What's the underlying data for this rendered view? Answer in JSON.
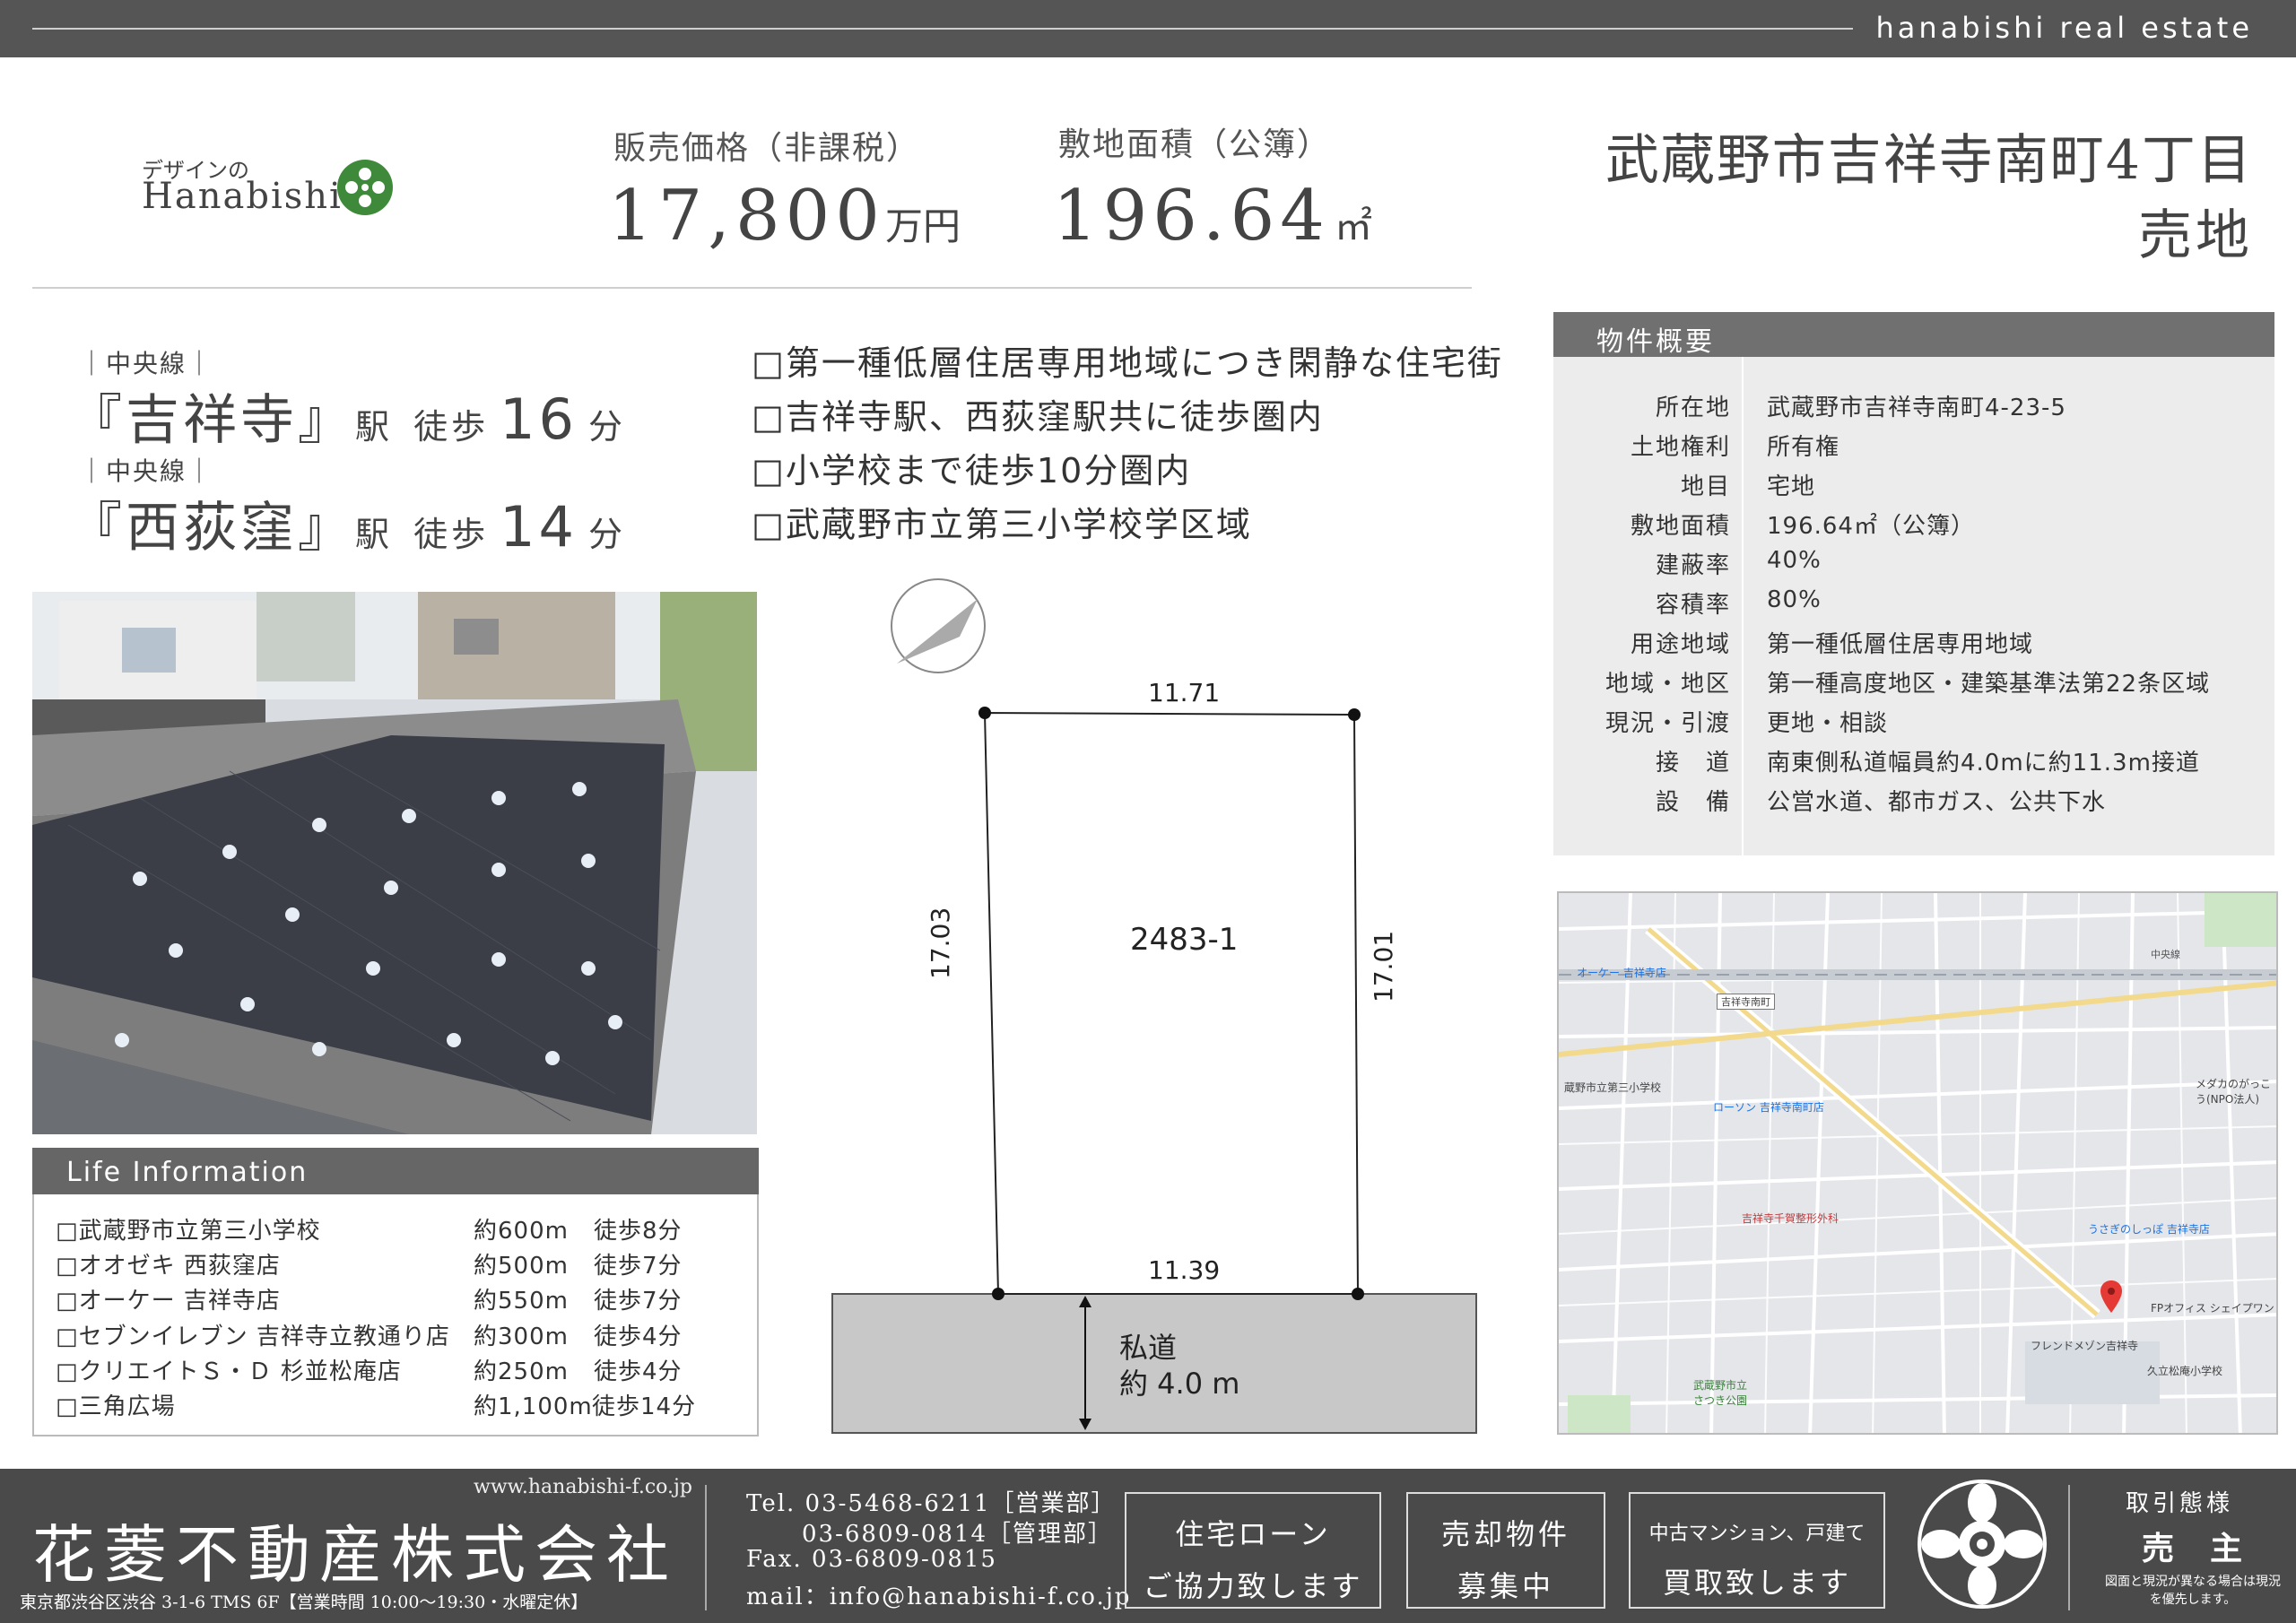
{
  "top_bar": {
    "brand": "hanabishi real estate"
  },
  "logo": {
    "sub": "デザインの",
    "name": "Hanabishi"
  },
  "price": {
    "label": "販売価格（非課税）",
    "value": "17,800",
    "unit": "万円"
  },
  "area": {
    "label": "敷地面積（公簿）",
    "value": "196.64",
    "unit": "㎡"
  },
  "title": {
    "line1": "武蔵野市吉祥寺南町4丁目",
    "line2": "売地"
  },
  "stations": [
    {
      "line": "｜中央線｜",
      "name": "『吉祥寺』",
      "eki": "駅",
      "walk": "徒歩",
      "minutes": "16",
      "fun": "分"
    },
    {
      "line": "｜中央線｜",
      "name": "『西荻窪』",
      "eki": "駅",
      "walk": "徒歩",
      "minutes": "14",
      "fun": "分"
    }
  ],
  "features": [
    "□第一種低層住居専用地域につき閑静な住宅街",
    "□吉祥寺駅、西荻窪駅共に徒歩圏内",
    "□小学校まで徒歩10分圏内",
    "□武蔵野市立第三小学校学区域"
  ],
  "plot": {
    "top_edge": "11.71",
    "bottom_edge": "11.39",
    "left_edge": "17.03",
    "right_edge": "17.01",
    "lot_number": "2483-1",
    "road_label": "私道",
    "road_width": "約 4.0 m"
  },
  "life_info": {
    "heading": "Life Information",
    "items": [
      {
        "name": "□武蔵野市立第三小学校",
        "distance": "約600m",
        "walk": "徒歩8分"
      },
      {
        "name": "□オオゼキ 西荻窪店",
        "distance": "約500m",
        "walk": "徒歩7分"
      },
      {
        "name": "□オーケー 吉祥寺店",
        "distance": "約550m",
        "walk": "徒歩7分"
      },
      {
        "name": "□セブンイレブン 吉祥寺立教通り店",
        "distance": "約300m",
        "walk": "徒歩4分"
      },
      {
        "name": "□クリエイトＳ・Ｄ 杉並松庵店",
        "distance": "約250m",
        "walk": "徒歩4分"
      },
      {
        "name": "□三角広場",
        "distance": "約1,100m",
        "walk": "徒歩14分"
      }
    ]
  },
  "property": {
    "heading": "物件概要",
    "rows": [
      {
        "key": "所在地",
        "value": "武蔵野市吉祥寺南町4-23-5"
      },
      {
        "key": "土地権利",
        "value": "所有権"
      },
      {
        "key": "地目",
        "value": "宅地"
      },
      {
        "key": "敷地面積",
        "value": "196.64㎡（公簿）"
      },
      {
        "key": "建蔽率",
        "value": "40%"
      },
      {
        "key": "容積率",
        "value": "80%"
      },
      {
        "key": "用途地域",
        "value": "第一種低層住居専用地域"
      },
      {
        "key": "地域・地区",
        "value": "第一種高度地区・建築基準法第22条区域"
      },
      {
        "key": "現況・引渡",
        "value": "更地・相談"
      },
      {
        "key": "接　道",
        "value": "南東側私道幅員約4.0mに約11.3m接道"
      },
      {
        "key": "設　備",
        "value": "公営水道、都市ガス、公共下水"
      }
    ]
  },
  "map_labels": {
    "ok": "オーケー 吉祥寺店",
    "school": "蔵野市立第三小学校",
    "lawson": "ローソン 吉祥寺南町店",
    "medaka": "メダカのがっこう(NPO法人)",
    "clinic": "吉祥寺千賀整形外科",
    "usagi": "うさぎのしっぽ 吉祥寺店",
    "fp": "FPオフィス シェイプワン",
    "friend": "フレンドメゾン吉祥寺",
    "park": "武蔵野市立 さつき公園",
    "kodai": "久立松庵小学校",
    "station_sign": "吉祥寺南町",
    "chuo": "中央線"
  },
  "footer": {
    "url": "www.hanabishi-f.co.jp",
    "company": "花菱不動産株式会社",
    "address": "東京都渋谷区渋谷 3-1-6 TMS 6F【営業時間 10:00〜19:30・水曜定休】",
    "tel1": "Tel. 03-5468-6211［営業部］",
    "tel2": "03-6809-0814［管理部］",
    "fax": "Fax. 03-6809-0815",
    "mail": "mail：info@hanabishi-f.co.jp",
    "box1": [
      "住宅ローン",
      "ご協力致します"
    ],
    "box2": [
      "売却物件",
      "募集中"
    ],
    "box3": [
      "中古マンション、戸建て",
      "買取致します"
    ],
    "deal_label": "取引態様",
    "deal_value": "売　主",
    "note": "図面と現況が異なる場合は現況を優先します。"
  }
}
